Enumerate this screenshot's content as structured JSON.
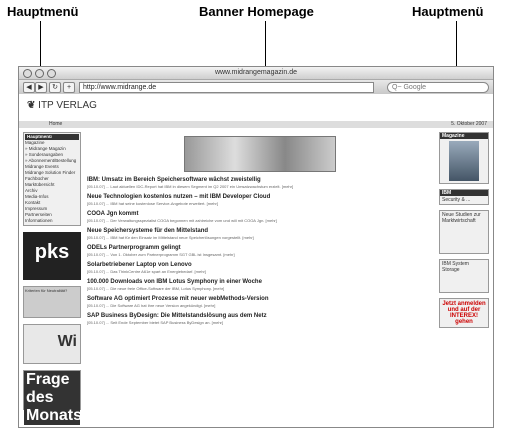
{
  "callouts": {
    "left": "Hauptmenü",
    "center": "Banner Homepage",
    "right": "Hauptmenü"
  },
  "window": {
    "title": "www.midrangemagazin.de",
    "url": "http://www.midrange.de",
    "search_placeholder": "Q~ Google"
  },
  "site": {
    "logo": "ITP VERLAG",
    "breadcrumb": "Home",
    "date": "5. Oktober 2007"
  },
  "left_nav": {
    "heading": "Hauptmenü",
    "items": [
      "Magazine",
      "» Midrange Magazin",
      "» Sonderausgaben",
      "» Abonnement/Bestellung",
      "Midrange Events",
      "Midrange Solution Finder",
      "Fachbücher",
      "Marktübersicht",
      "Archiv",
      "Media-Infos",
      "Kontakt",
      "Impressum",
      "Partnerseiten",
      "Informationen"
    ],
    "pks": "pks",
    "box_label": "Kriterien für Neutralität?",
    "widget_label": "Wi",
    "box2_label": "Frage des Monats"
  },
  "articles": [
    {
      "title": "IBM: Umsatz im Bereich Speichersoftware wächst zweistellig",
      "text": "[05.10.07] ... Laut aktuellen IDC-Report hat IBM in diesem Segment im Q2 2007 ein Umsatzwachstum erzielt. [mehr]"
    },
    {
      "title": "Neue Technologien kostenlos nutzen – mit IBM Developer Cloud",
      "text": "[05.10.07] ... IBM hat seine kostenlose Service-Angebote erweitert. [mehr]"
    },
    {
      "title": "COOA Jgn kommt",
      "text": "[05.10.07] ... Der Verwaltungsspezialist COOA begonnen mit zahlreiche vom und will mit COOA Jgn. [mehr]"
    },
    {
      "title": "Neue Speichersysteme für den Mittelstand",
      "text": "[05.10.07] ... IBM hat für den Einsatz im Mittelstand neue Speicherlösungen vorgestellt. [mehr]"
    },
    {
      "title": "ODELs Partnerprogramm gelingt",
      "text": "[05.10.07] ... Von 1. Oktober zum Partnerprogramm SGT GBL ist Insgesamt. [mehr]"
    },
    {
      "title": "Solarbetriebener Laptop von Lenovo",
      "text": "[05.10.07] ... Das ThinkCentre A61e spart an Energiebedarf. [mehr]"
    },
    {
      "title": "100.000 Downloads von IBM Lotus Symphony in einer Woche",
      "text": "[05.10.07] ... Die neue freie Office-Software der IBM, Lotus Symphony. [mehr]"
    },
    {
      "title": "Software AG optimiert Prozesse mit neuer webMethods-Version",
      "text": "[05.10.07] ... Die Software AG hat ihre neue Version angekündigt. [mehr]"
    },
    {
      "title": "SAP Business ByDesign: Die Mittelstandslösung aus dem Netz",
      "text": "[05.10.07] ... Seit Ende September bietet SAP Business ByDesign an. [mehr]"
    }
  ],
  "right_nav": {
    "heading": "Magazine",
    "items": [
      "IBM",
      "Security & ...",
      "Neue Studien zur Marktwirtschaft",
      "IBM System Storage"
    ],
    "promo": "Jetzt anmelden und auf der INTEREX! gehen"
  }
}
